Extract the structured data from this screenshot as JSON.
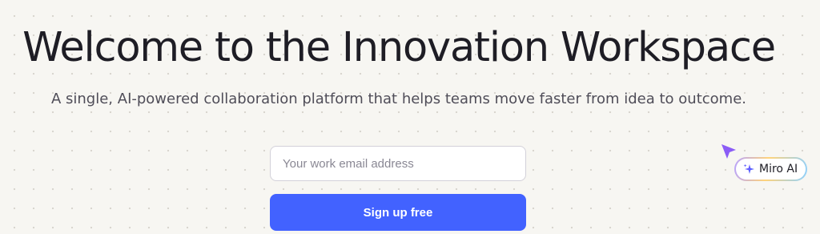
{
  "hero": {
    "headline": "Welcome to the Innovation Workspace",
    "subheadline": "A single, AI-powered collaboration platform that helps teams move faster from idea to outcome."
  },
  "signup": {
    "email_placeholder": "Your work email address",
    "email_value": "",
    "button_label": "Sign up free"
  },
  "ai_badge": {
    "label": "Miro AI",
    "icon": "sparkle-icon"
  },
  "cursor": {
    "icon": "cursor-arrow-icon"
  },
  "colors": {
    "background": "#f7f6f2",
    "primary_button": "#4262ff",
    "cursor": "#8b5cf6",
    "headline": "#1e1d25",
    "subheadline": "#4f4d58"
  }
}
